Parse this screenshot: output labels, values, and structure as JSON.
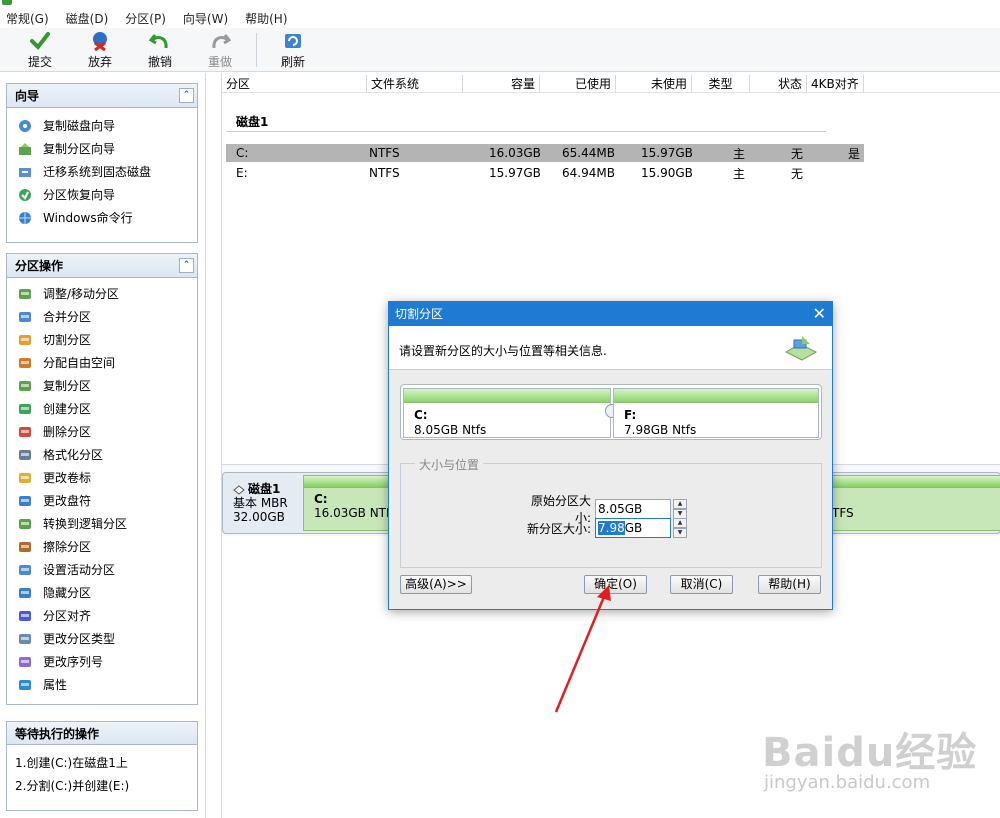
{
  "menu": [
    "常规(G)",
    "磁盘(D)",
    "分区(P)",
    "向导(W)",
    "帮助(H)"
  ],
  "toolbar": {
    "commit": "提交",
    "discard": "放弃",
    "undo": "撤销",
    "redo": "重做",
    "refresh": "刷新"
  },
  "wizard_panel": {
    "title": "向导",
    "items": [
      "复制磁盘向导",
      "复制分区向导",
      "迁移系统到固态磁盘",
      "分区恢复向导",
      "Windows命令行"
    ]
  },
  "partition_ops": {
    "title": "分区操作",
    "items": [
      "调整/移动分区",
      "合并分区",
      "切割分区",
      "分配自由空间",
      "复制分区",
      "创建分区",
      "删除分区",
      "格式化分区",
      "更改卷标",
      "更改盘符",
      "转换到逻辑分区",
      "擦除分区",
      "设置活动分区",
      "隐藏分区",
      "分区对齐",
      "更改分区类型",
      "更改序列号",
      "属性"
    ]
  },
  "pending": {
    "title": "等待执行的操作",
    "items": [
      "1.创建(C:)在磁盘1上",
      "2.分割(C:)并创建(E:)"
    ]
  },
  "table": {
    "columns": [
      "分区",
      "文件系统",
      "容量",
      "已使用",
      "未使用",
      "类型",
      "状态",
      "4KB对齐"
    ],
    "disk_label": "磁盘1",
    "rows": [
      {
        "partition": "C:",
        "fs": "NTFS",
        "capacity": "16.03GB",
        "used": "65.44MB",
        "unused": "15.97GB",
        "type": "主",
        "status": "无",
        "align4k": "是"
      },
      {
        "partition": "E:",
        "fs": "NTFS",
        "capacity": "15.97GB",
        "used": "64.94MB",
        "unused": "15.90GB",
        "type": "主",
        "status": "无",
        "align4k": ""
      }
    ]
  },
  "disk_map": {
    "name": "磁盘1",
    "type": "基本 MBR",
    "size": "32.00GB",
    "partition_name": "C:",
    "partition_size": "16.03GB NTFS",
    "partition2_size": "TFS"
  },
  "dialog": {
    "title": "切割分区",
    "hint": "请设置新分区的大小与位置等相关信息.",
    "left_part": {
      "name": "C:",
      "size": "8.05GB Ntfs"
    },
    "right_part": {
      "name": "F:",
      "size": "7.98GB Ntfs"
    },
    "group_title": "大小与位置",
    "original_label": "原始分区大小:",
    "original_value": "8.05GB",
    "new_label": "新分区大小:",
    "new_value_selected": "7.98",
    "new_value_unit": "GB",
    "advanced_button": "高级(A)>>",
    "ok_button": "确定(O)",
    "cancel_button": "取消(C)",
    "help_button": "帮助(H)"
  },
  "watermark": {
    "brand": "Baidu经验",
    "url": "jingyan.baidu.com"
  },
  "colors": {
    "accent": "#1f7ad1",
    "partition_green": "#8bd36a",
    "annotation_red": "#e02020"
  }
}
